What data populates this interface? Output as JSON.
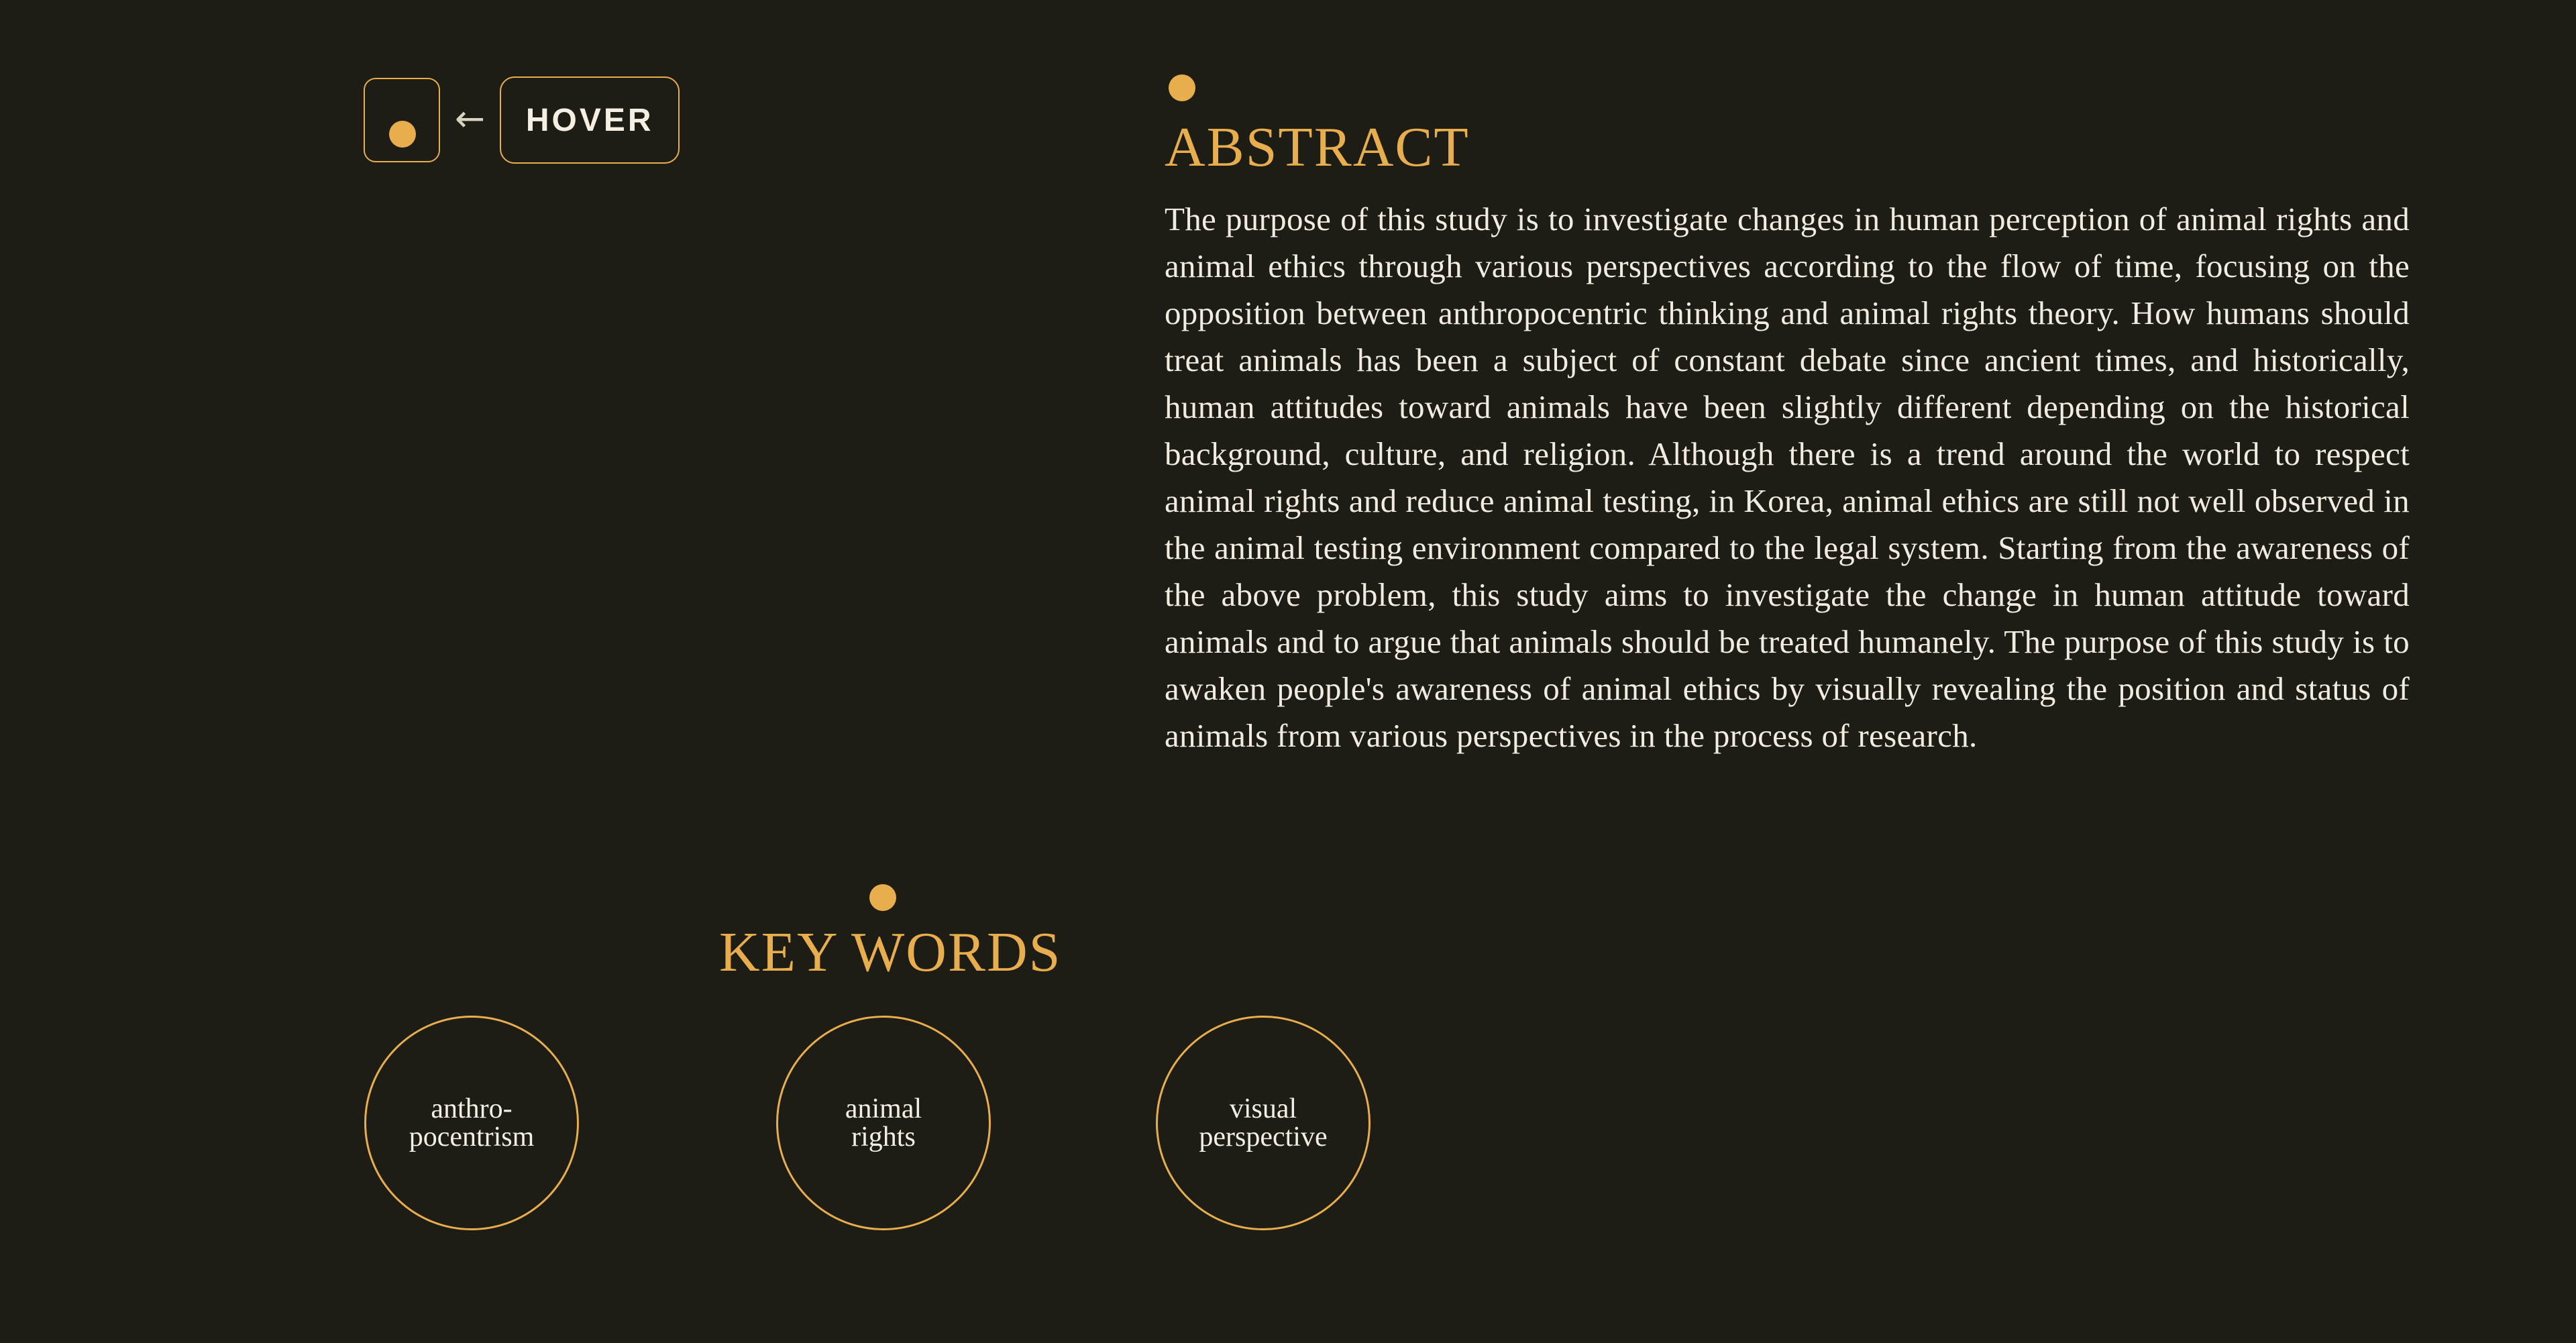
{
  "hover_control": {
    "arrow_glyph": "←",
    "button_label": "HOVER"
  },
  "abstract": {
    "heading": "ABSTRACT",
    "body": "The purpose of this study is to investigate changes in human perception of animal rights and animal ethics through various perspectives according to the flow of time, focusing on the opposition between anthropocentric thinking and animal rights theory. How humans should treat animals has been a subject of constant debate since ancient times, and historically, human attitudes toward animals have been slightly different depending on the historical background, culture, and religion. Although there is a trend around the world to respect animal rights and reduce animal testing, in Korea, animal ethics are still not well observed in the animal testing environment compared to the legal system. Starting from the awareness of the above problem, this study aims to investigate the change in human attitude toward animals and to argue that animals should be treated humanely. The purpose of this study is to awaken people's awareness of animal ethics by visually revealing the position and status of animals from various perspectives in the process of research."
  },
  "keywords": {
    "heading": "KEY WORDS",
    "items": [
      {
        "label": "anthro-\npocentrism"
      },
      {
        "label": "animal\nrights"
      },
      {
        "label": "visual\nperspective"
      }
    ]
  },
  "colors": {
    "background": "#1d1c15",
    "accent": "#e8ad4c",
    "text": "#f1ecdf"
  }
}
